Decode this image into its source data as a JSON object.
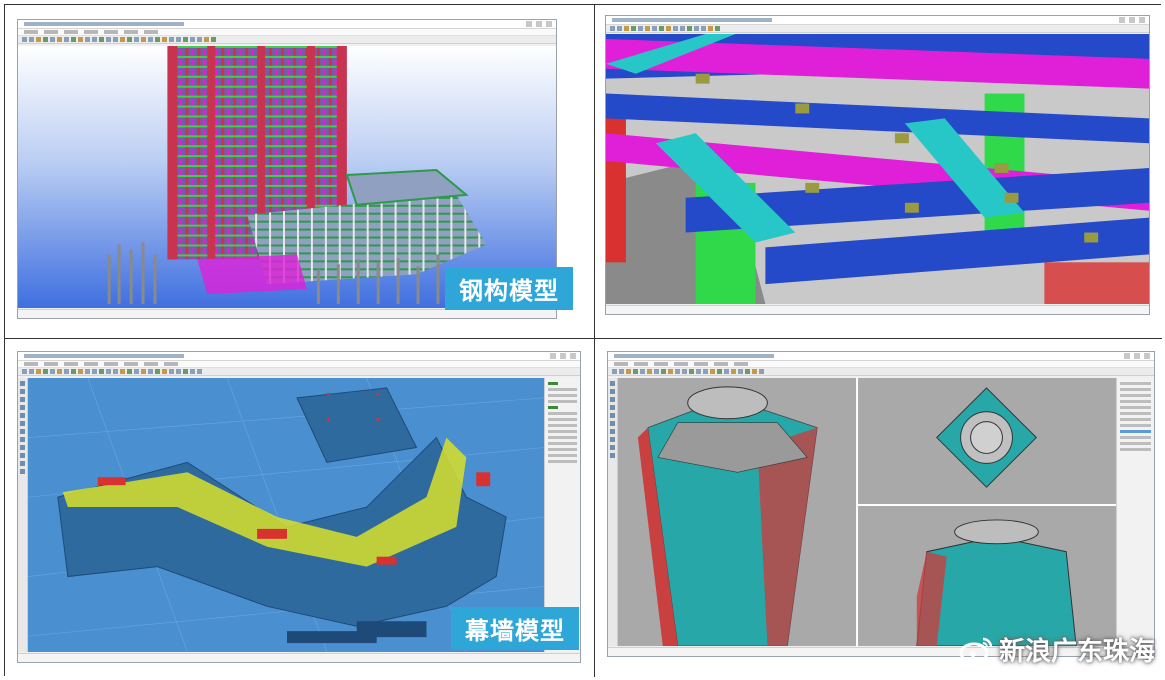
{
  "panels": [
    {
      "label": "钢构模型"
    },
    {
      "label": "幕墙模型"
    }
  ],
  "watermark": {
    "text": "新浪广东珠海",
    "logo": "weibo-eye-icon"
  },
  "colors": {
    "label_bg": "#2ea7d8",
    "steel_red": "#c8334f",
    "beam_blue": "#2449c9",
    "beam_magenta": "#e01fd9",
    "curtain_blue": "#3c7bb0",
    "curtain_yellow": "#d8e02a",
    "tower_teal": "#27a7a7"
  }
}
